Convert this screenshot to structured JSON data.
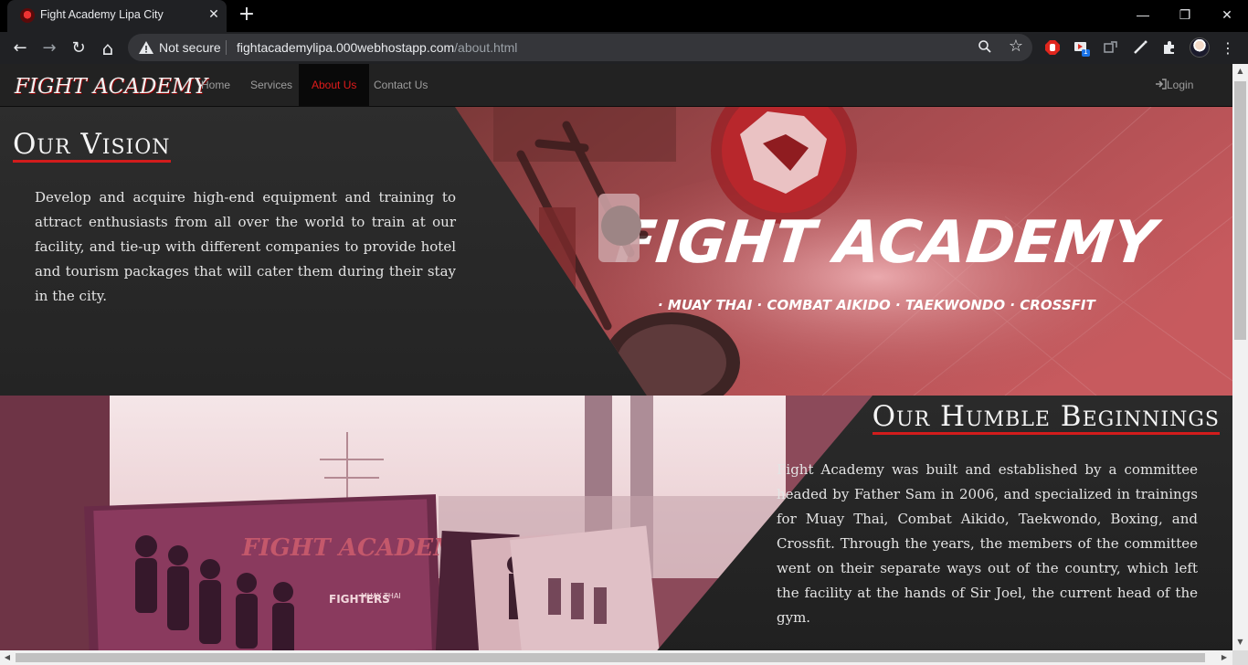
{
  "browser": {
    "tab_title": "Fight Academy Lipa City",
    "tab_close_glyph": "✕",
    "new_tab_glyph": "+",
    "window_controls": {
      "minimize": "—",
      "restore": "❐",
      "close": "✕"
    },
    "nav": {
      "back": "←",
      "forward": "→",
      "reload": "↻",
      "home": "⌂"
    },
    "security_label": "Not secure",
    "url_domain": "fightacademylipa.000webhostapp.com",
    "url_path": "/about.html",
    "zoom_glyph": "⚲",
    "star_glyph": "☆",
    "extension_badge": "1",
    "menu_glyph": "⋮"
  },
  "site": {
    "logo_text": "FIGHT ACADEMY",
    "nav_items": [
      {
        "label": "Home",
        "active": false
      },
      {
        "label": "Services",
        "active": false
      },
      {
        "label": "About Us",
        "active": true
      },
      {
        "label": "Contact Us",
        "active": false
      }
    ],
    "login_label": "Login",
    "login_icon": "login-icon",
    "accent_color": "#d21c1c",
    "vision": {
      "heading": "Our Vision",
      "body": "Develop and acquire high-end equipment and training to attract enthusiasts from all over the world to train at our facility, and tie-up with different companies to provide hotel and tourism packages that will cater them during their stay in the city.",
      "banner_title": "FIGHT ACADEMY",
      "banner_subtitle": "· MUAY THAI · COMBAT AIKIDO · TAEKWONDO · CROSSFIT"
    },
    "beginnings": {
      "heading": "Our Humble Beginnings",
      "body": "Fight Academy was built and established by a committee headed by Father Sam in 2006, and specialized in trainings for Muay Thai, Combat Aikido, Taekwondo, Boxing, and Crossfit. Through the years, the members of the committee went on their separate ways out of the country, which left the facility at the hands of Sir Joel, the current head of the gym.",
      "poster_title": "FIGHT ACADEMY",
      "poster_small": "MUAY THAI",
      "poster_sub": "FIGHTERS"
    }
  }
}
